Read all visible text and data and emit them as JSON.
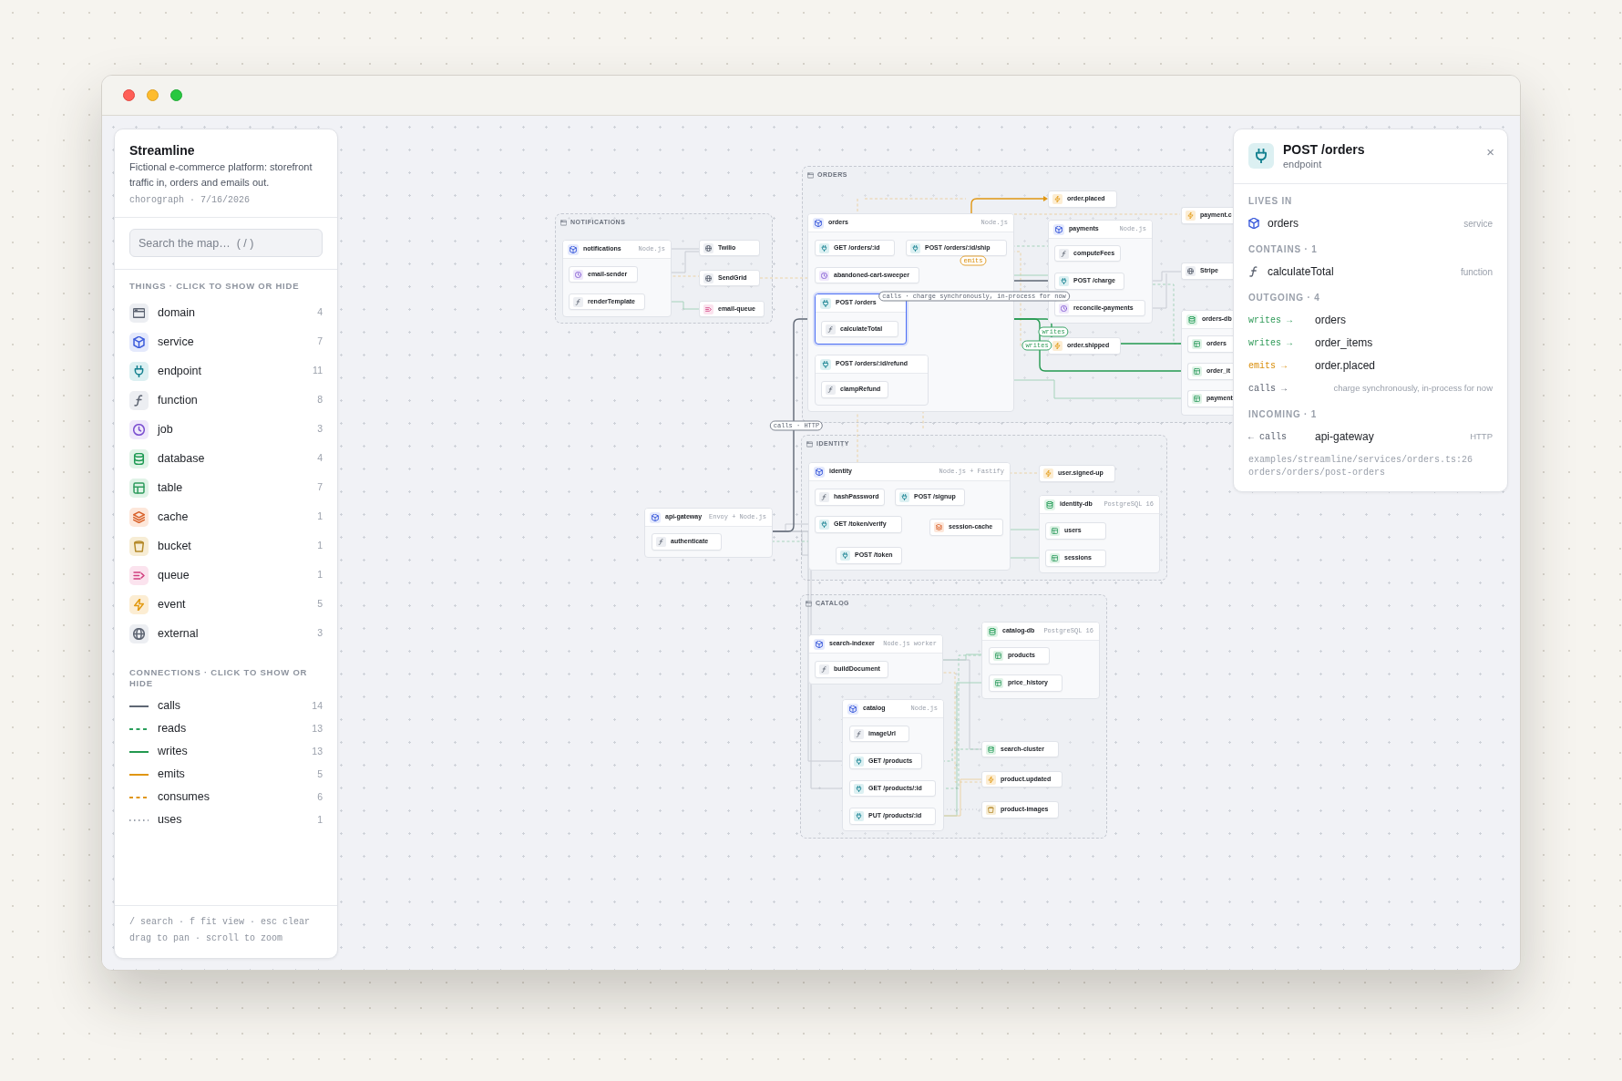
{
  "sidebar": {
    "title": "Streamline",
    "description": "Fictional e-commerce platform: storefront traffic in, orders and emails out.",
    "meta": "chorograph · 7/16/2026",
    "search": {
      "placeholder": "Search the map…  ( / )"
    },
    "things_heading": "THINGS · CLICK TO SHOW OR HIDE",
    "things": [
      {
        "kind": "domain",
        "label": "domain",
        "count": "4"
      },
      {
        "kind": "service",
        "label": "service",
        "count": "7"
      },
      {
        "kind": "endpoint",
        "label": "endpoint",
        "count": "11"
      },
      {
        "kind": "function",
        "label": "function",
        "count": "8"
      },
      {
        "kind": "job",
        "label": "job",
        "count": "3"
      },
      {
        "kind": "database",
        "label": "database",
        "count": "4"
      },
      {
        "kind": "table",
        "label": "table",
        "count": "7"
      },
      {
        "kind": "cache",
        "label": "cache",
        "count": "1"
      },
      {
        "kind": "bucket",
        "label": "bucket",
        "count": "1"
      },
      {
        "kind": "queue",
        "label": "queue",
        "count": "1"
      },
      {
        "kind": "event",
        "label": "event",
        "count": "5"
      },
      {
        "kind": "external",
        "label": "external",
        "count": "3"
      }
    ],
    "connections_heading": "CONNECTIONS · CLICK TO SHOW OR HIDE",
    "connections": [
      {
        "kind": "calls",
        "label": "calls",
        "count": "14"
      },
      {
        "kind": "reads",
        "label": "reads",
        "count": "13"
      },
      {
        "kind": "writes",
        "label": "writes",
        "count": "13"
      },
      {
        "kind": "emits",
        "label": "emits",
        "count": "5"
      },
      {
        "kind": "consumes",
        "label": "consumes",
        "count": "6"
      },
      {
        "kind": "uses",
        "label": "uses",
        "count": "1"
      }
    ],
    "footer": [
      "/ search · f fit view · esc clear",
      "drag to pan · scroll to zoom"
    ]
  },
  "canvas": {
    "groups": [
      {
        "label": "NOTIFICATIONS",
        "nodes": [
          {
            "kind": "service",
            "label": "notifications",
            "meta": "Node.js",
            "selected": false,
            "children": [
              {
                "kind": "job",
                "label": "email-sender",
                "selected": false
              },
              {
                "kind": "function",
                "label": "renderTemplate",
                "selected": false
              }
            ]
          },
          {
            "kind": "external",
            "label": "Twilio",
            "selected": false
          },
          {
            "kind": "external",
            "label": "SendGrid",
            "selected": false
          },
          {
            "kind": "queue",
            "label": "email-queue",
            "selected": false
          }
        ]
      },
      {
        "label": "ORDERS",
        "nodes": [
          {
            "kind": "service",
            "label": "orders",
            "meta": "Node.js",
            "selected": false,
            "children": [
              {
                "kind": "endpoint",
                "label": "GET /orders/:id",
                "selected": false
              },
              {
                "kind": "endpoint",
                "label": "POST /orders/:id/ship",
                "selected": false
              },
              {
                "kind": "job",
                "label": "abandoned-cart-sweeper",
                "selected": false
              },
              {
                "kind": "endpoint",
                "label": "POST /orders",
                "selected": true,
                "children": [
                  {
                    "kind": "function",
                    "label": "calculateTotal",
                    "selected": false
                  }
                ]
              },
              {
                "kind": "endpoint",
                "label": "POST /orders/:id/refund",
                "selected": false,
                "children": [
                  {
                    "kind": "function",
                    "label": "clampRefund",
                    "selected": false
                  }
                ]
              }
            ]
          },
          {
            "kind": "event",
            "label": "order.placed",
            "selected": false
          },
          {
            "kind": "service",
            "label": "payments",
            "meta": "Node.js",
            "selected": false,
            "children": [
              {
                "kind": "function",
                "label": "computeFees",
                "selected": false
              },
              {
                "kind": "endpoint",
                "label": "POST /charge",
                "selected": false
              },
              {
                "kind": "job",
                "label": "reconcile-payments",
                "selected": false
              }
            ]
          },
          {
            "kind": "event",
            "label": "order.shipped",
            "selected": false
          },
          {
            "kind": "event",
            "label": "payment.c",
            "selected": false
          },
          {
            "kind": "external",
            "label": "Stripe",
            "selected": false
          },
          {
            "kind": "database",
            "label": "orders-db",
            "selected": false,
            "children": [
              {
                "kind": "table",
                "label": "orders",
                "selected": false
              },
              {
                "kind": "table",
                "label": "order_it",
                "selected": false
              },
              {
                "kind": "table",
                "label": "payment",
                "selected": false
              }
            ]
          }
        ]
      },
      {
        "label": "IDENTITY",
        "nodes": [
          {
            "kind": "service",
            "label": "identity",
            "meta": "Node.js + Fastify",
            "selected": false,
            "children": [
              {
                "kind": "function",
                "label": "hashPassword",
                "selected": false
              },
              {
                "kind": "endpoint",
                "label": "POST /signup",
                "selected": false
              },
              {
                "kind": "endpoint",
                "label": "GET /token/verify",
                "selected": false
              },
              {
                "kind": "cache",
                "label": "session-cache",
                "selected": false
              },
              {
                "kind": "endpoint",
                "label": "POST /token",
                "selected": false
              }
            ]
          },
          {
            "kind": "event",
            "label": "user.signed-up",
            "selected": false
          },
          {
            "kind": "database",
            "label": "identity-db",
            "meta": "PostgreSQL 16",
            "selected": false,
            "children": [
              {
                "kind": "table",
                "label": "users",
                "selected": false
              },
              {
                "kind": "table",
                "label": "sessions",
                "selected": false
              }
            ]
          }
        ]
      },
      {
        "label": "CATALOG",
        "nodes": [
          {
            "kind": "service",
            "label": "search-indexer",
            "meta": "Node.js worker",
            "selected": false,
            "children": [
              {
                "kind": "function",
                "label": "buildDocument",
                "selected": false
              }
            ]
          },
          {
            "kind": "service",
            "label": "catalog",
            "meta": "Node.js",
            "selected": false,
            "children": [
              {
                "kind": "function",
                "label": "imageUrl",
                "selected": false
              },
              {
                "kind": "endpoint",
                "label": "GET /products",
                "selected": false
              },
              {
                "kind": "endpoint",
                "label": "GET /products/:id",
                "selected": false
              },
              {
                "kind": "endpoint",
                "label": "PUT /products/:id",
                "selected": false
              }
            ]
          },
          {
            "kind": "database",
            "label": "catalog-db",
            "meta": "PostgreSQL 16",
            "selected": false,
            "children": [
              {
                "kind": "table",
                "label": "products",
                "selected": false
              },
              {
                "kind": "table",
                "label": "price_history",
                "selected": false
              }
            ]
          },
          {
            "kind": "database",
            "label": "search-cluster",
            "selected": false
          },
          {
            "kind": "event",
            "label": "product.updated",
            "selected": false
          },
          {
            "kind": "bucket",
            "label": "product-images",
            "selected": false
          }
        ]
      }
    ],
    "nodes": [
      {
        "kind": "service",
        "label": "api-gateway",
        "meta": "Envoy + Node.js",
        "selected": false,
        "children": [
          {
            "kind": "function",
            "label": "authenticate",
            "selected": false
          }
        ]
      }
    ],
    "edges": [
      {
        "kind": "calls",
        "label": "calls · HTTP"
      },
      {
        "kind": "emits",
        "label": "emits"
      },
      {
        "kind": "calls",
        "label": "calls · charge synchronously, in-process for now"
      },
      {
        "kind": "writes",
        "label": "writes"
      },
      {
        "kind": "writes",
        "label": "writes"
      }
    ]
  },
  "details": {
    "kind": "endpoint",
    "title": "POST /orders",
    "subtitle": "endpoint",
    "close": "×",
    "lives_in": {
      "heading": "LIVES IN",
      "items": [
        {
          "kind": "service",
          "name": "orders",
          "type": "service"
        }
      ]
    },
    "contains": {
      "heading": "CONTAINS · 1",
      "items": [
        {
          "kind": "function",
          "name": "calculateTotal",
          "type": "function"
        }
      ]
    },
    "outgoing": {
      "heading": "OUTGOING · 4",
      "items": [
        {
          "kind": "writes",
          "relation": "writes →",
          "target": "orders"
        },
        {
          "kind": "writes",
          "relation": "writes →",
          "target": "order_items"
        },
        {
          "kind": "emits",
          "relation": "emits →",
          "target": "order.placed"
        },
        {
          "kind": "calls",
          "relation": "calls →",
          "note": "charge synchronously, in-process for now"
        }
      ]
    },
    "incoming": {
      "heading": "INCOMING · 1",
      "items": [
        {
          "kind": "calls",
          "relation": "← calls",
          "target": "api-gateway",
          "note": "HTTP"
        }
      ]
    },
    "source": [
      "examples/streamline/services/orders.ts:26",
      "orders/orders/post-orders"
    ]
  }
}
